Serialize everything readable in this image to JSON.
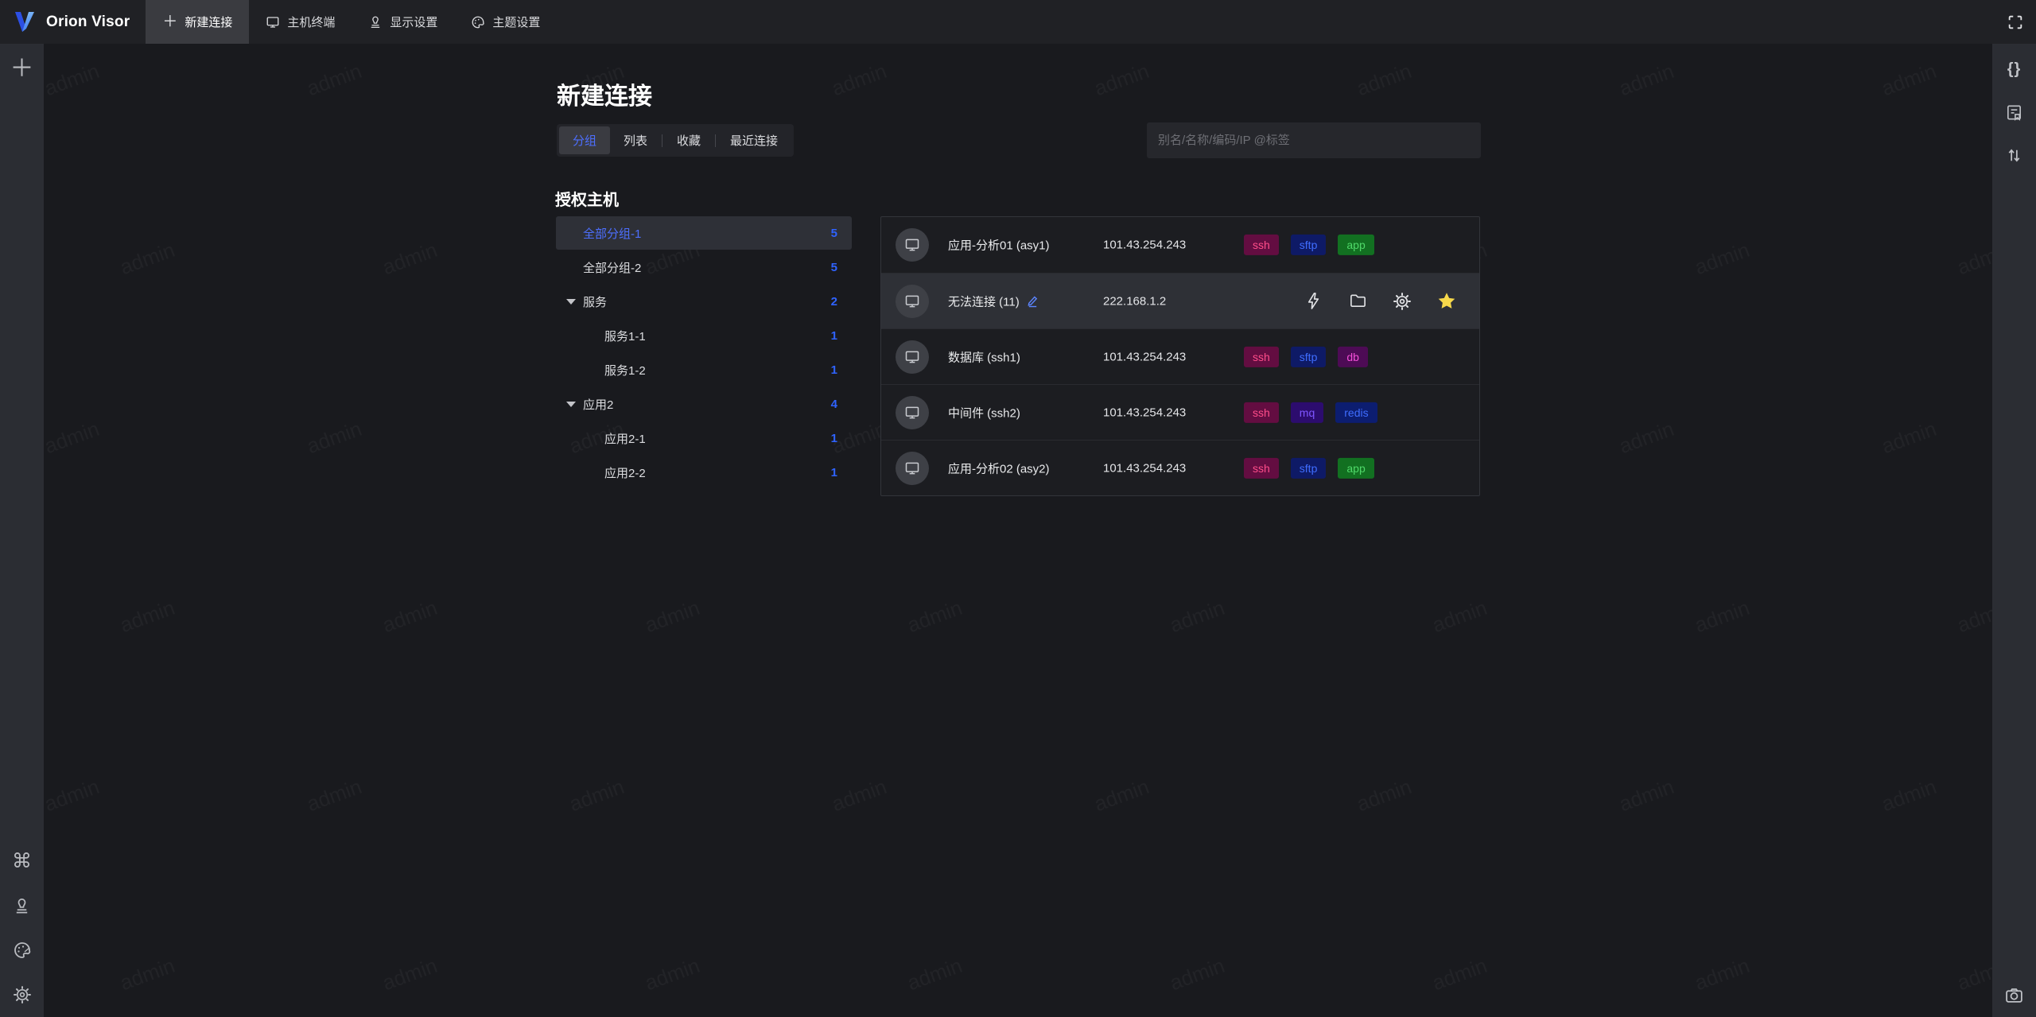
{
  "app": {
    "logo_text": "Orion Visor"
  },
  "topbar": {
    "tabs": [
      {
        "label": "新建连接",
        "icon": "plus-icon",
        "active": true
      },
      {
        "label": "主机终端",
        "icon": "monitor-icon",
        "active": false
      },
      {
        "label": "显示设置",
        "icon": "stamp-icon",
        "active": false
      },
      {
        "label": "主题设置",
        "icon": "palette-icon",
        "active": false
      }
    ],
    "fullscreen_icon": "corner-brackets"
  },
  "left_rail": {
    "icons": [
      "plus-icon",
      "command-icon",
      "stamp-icon",
      "palette-icon",
      "gear-icon"
    ]
  },
  "right_rail": {
    "icons": [
      "braces-icon",
      "doc-bookmark-icon",
      "sort-arrows-icon",
      "camera-icon"
    ],
    "braces_glyph": "{}",
    "command_glyph": "⌘"
  },
  "page": {
    "title": "新建连接"
  },
  "view_tabs": {
    "items": [
      {
        "label": "分组",
        "active": true
      },
      {
        "label": "列表",
        "active": false
      },
      {
        "label": "收藏",
        "active": false
      },
      {
        "label": "最近连接",
        "active": false
      }
    ]
  },
  "search": {
    "placeholder": "别名/名称/编码/IP @标签",
    "value": ""
  },
  "tree": {
    "header": "授权主机",
    "items": [
      {
        "label": "全部分组-1",
        "count": "5",
        "level": 0,
        "selected": true,
        "expanded": null
      },
      {
        "label": "全部分组-2",
        "count": "5",
        "level": 0,
        "selected": false,
        "expanded": null
      },
      {
        "label": "服务",
        "count": "2",
        "level": 0,
        "selected": false,
        "expanded": true
      },
      {
        "label": "服务1-1",
        "count": "1",
        "level": 1,
        "selected": false,
        "expanded": null
      },
      {
        "label": "服务1-2",
        "count": "1",
        "level": 1,
        "selected": false,
        "expanded": null
      },
      {
        "label": "应用2",
        "count": "4",
        "level": 0,
        "selected": false,
        "expanded": true
      },
      {
        "label": "应用2-1",
        "count": "1",
        "level": 1,
        "selected": false,
        "expanded": null
      },
      {
        "label": "应用2-2",
        "count": "1",
        "level": 1,
        "selected": false,
        "expanded": null
      }
    ]
  },
  "hosts": [
    {
      "name": "应用-分析01 (asy1)",
      "ip": "101.43.254.243",
      "tags": [
        {
          "label": "ssh",
          "type": "ssh"
        },
        {
          "label": "sftp",
          "type": "sftp"
        },
        {
          "label": "app",
          "type": "app"
        }
      ]
    },
    {
      "name": "无法连接 (11)",
      "ip": "222.168.1.2",
      "hovered": true,
      "edit_icon": "pencil-icon",
      "actions": [
        "bolt-icon",
        "folder-icon",
        "gear-icon",
        "star-icon"
      ],
      "favorite": true,
      "tags": []
    },
    {
      "name": "数据库 (ssh1)",
      "ip": "101.43.254.243",
      "tags": [
        {
          "label": "ssh",
          "type": "ssh"
        },
        {
          "label": "sftp",
          "type": "sftp"
        },
        {
          "label": "db",
          "type": "db"
        }
      ]
    },
    {
      "name": "中间件 (ssh2)",
      "ip": "101.43.254.243",
      "tags": [
        {
          "label": "ssh",
          "type": "ssh"
        },
        {
          "label": "mq",
          "type": "mq"
        },
        {
          "label": "redis",
          "type": "redis"
        }
      ]
    },
    {
      "name": "应用-分析02 (asy2)",
      "ip": "101.43.254.243",
      "tags": [
        {
          "label": "ssh",
          "type": "ssh"
        },
        {
          "label": "sftp",
          "type": "sftp"
        },
        {
          "label": "app",
          "type": "app"
        }
      ]
    }
  ],
  "watermark": {
    "text": "admin"
  },
  "colors": {
    "accent_blue": "#4d6fff",
    "count_blue": "#2f63ff",
    "star_yellow": "#f6d84b",
    "topbar_bg": "#202125",
    "rail_bg": "#2b2d33",
    "content_bg": "#191a1e",
    "hover_row_bg": "#2e3036",
    "tag_ssh": {
      "bg": "#630d41",
      "text": "#ff4d8a"
    },
    "tag_sftp": {
      "bg": "#0e1a66",
      "text": "#3f6dff"
    },
    "tag_app": {
      "bg": "#127021",
      "text": "#4fd969"
    },
    "tag_db": {
      "bg": "#4d0b55",
      "text": "#f44fd8"
    },
    "tag_mq": {
      "bg": "#2c0c6e",
      "text": "#7e55ff"
    },
    "tag_redis": {
      "bg": "#0c1d70",
      "text": "#3f6dff"
    }
  }
}
